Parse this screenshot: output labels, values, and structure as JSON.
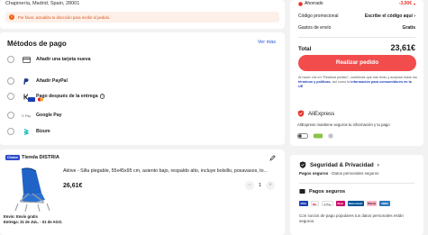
{
  "address": {
    "line": "Chapinería, Madrid, Spain, 28001",
    "warning": "Por favor, actualiza tu dirección para recibir el pedido."
  },
  "payment": {
    "title": "Métodos de pago",
    "see_more": "Ver más",
    "methods": [
      {
        "label": "Añadir una tarjeta nueva",
        "icon": "credit-card-icon"
      },
      {
        "label": "Añadir PayPal",
        "icon": "paypal-icon"
      },
      {
        "label": "Pago después de la entrega",
        "icon": "klarna-icon"
      },
      {
        "label": "Google Pay",
        "icon": "google-pay-icon"
      },
      {
        "label": "Bizum",
        "icon": "bizum-icon"
      }
    ]
  },
  "store": {
    "badge": "Choice",
    "name": "Tienda DISTRIA",
    "product_title": "Aktive - Silla plegable, 55x45x95 cm, asiento bajo, respaldo alto, incluye bolsillo, posavasos, to...",
    "price": "26,61€",
    "quantity": "1",
    "shipping_line1": "Envío: Envío gratis",
    "shipping_line2": "Entrega: 31 de JUL. - 01 de AGO."
  },
  "summary": {
    "saved_label": "Ahorrado",
    "saved_value": "-3,00€",
    "promo_label": "Código promocional",
    "promo_value": "Escribe el código aquí",
    "shipping_label": "Gastos de envío",
    "shipping_value": "Gratis",
    "total_label": "Total",
    "total_value": "23,61€",
    "order_button": "Realizar pedido",
    "legal_prefix": "Al hacer clic en \"Realizar pedido\", confirmas que has leído y aceptas todos los ",
    "legal_link1": "términos y políticas",
    "legal_middle": ", así como la ",
    "legal_link2": "información para consumidores en la UE"
  },
  "aliexpress": {
    "name": "AliExpress",
    "description": "AliExpress mantiene seguros tu información y tu pago"
  },
  "security": {
    "title": "Seguridad & Privacidad",
    "subtitle_bold": "Pagos seguros",
    "subtitle_rest": " · Datos personales seguros",
    "payments_title": "Pagos seguros",
    "payment_logos": [
      "VISA",
      "MC",
      "G Pay",
      "iDeal",
      "Bancontact",
      "Klarna",
      "AMEX"
    ],
    "payments_desc": "Con socios de pago populares tus datos personales están seguros."
  },
  "colors": {
    "accent": "#f34c4c",
    "link": "#2355d6",
    "brand_blue": "#2b4bcc"
  }
}
